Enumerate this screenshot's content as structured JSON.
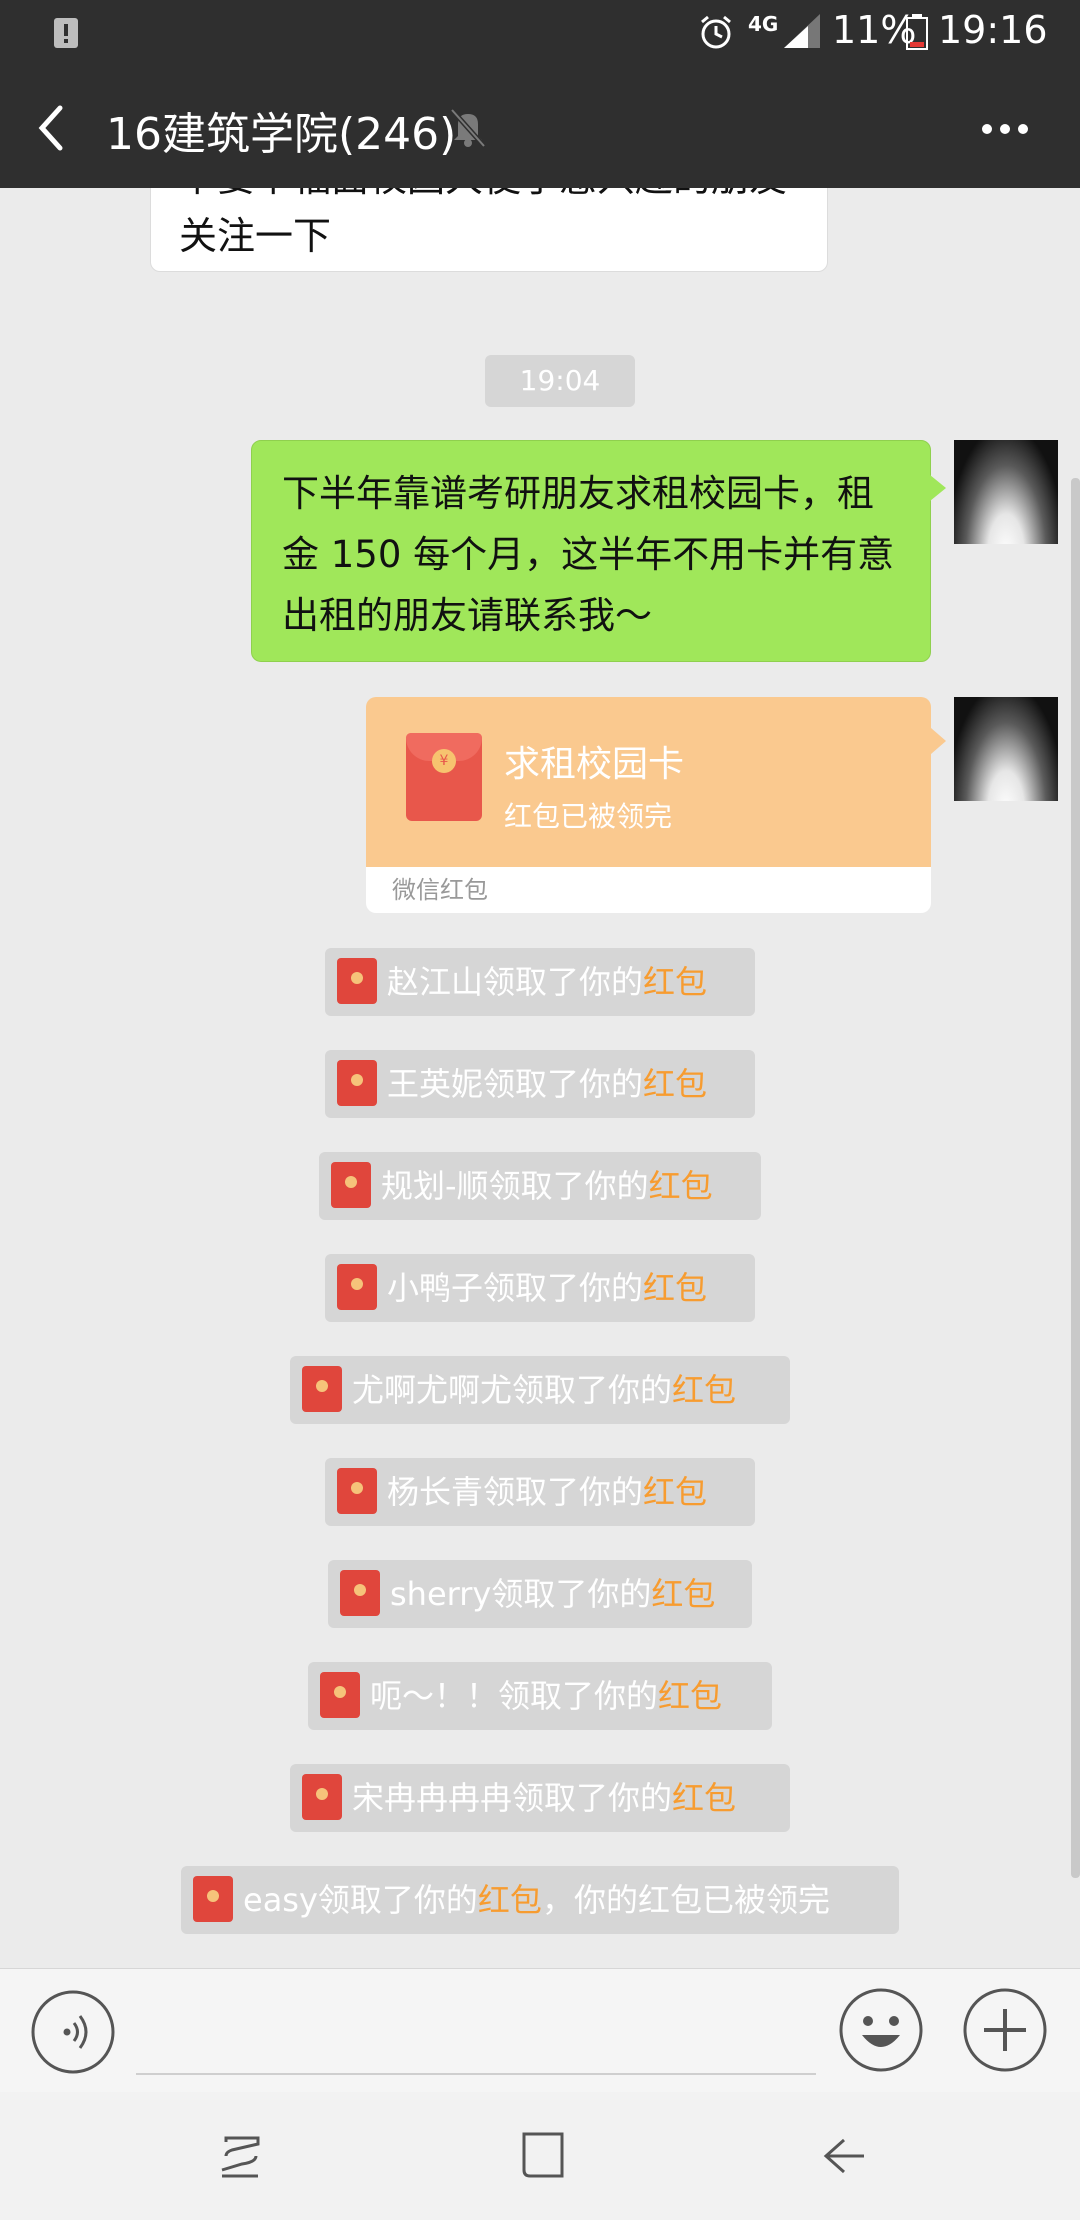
{
  "status_bar": {
    "network": "4G",
    "battery": "11%",
    "time": "19:16"
  },
  "header": {
    "title": "16建筑学院(246)"
  },
  "messages": {
    "partial_top_line": "下要下福面校园大使了感兴趣的朋友",
    "partial_bottom_line": "关注一下",
    "timestamp": "19:04",
    "green_line1": "下半年靠谱考研朋友求租校园卡，租",
    "green_line2": "金 150 每个月，这半年不用卡并有意",
    "green_line3": "出租的朋友请联系我～",
    "red_packet": {
      "title": "求租校园卡",
      "status": "红包已被领完",
      "footer": "微信红包",
      "coin": "¥"
    }
  },
  "notices": [
    {
      "name": "赵江山",
      "text": "领取了你的",
      "highlight": "红包",
      "tail": ""
    },
    {
      "name": "王英妮",
      "text": "领取了你的",
      "highlight": "红包",
      "tail": ""
    },
    {
      "name": "规划-顺",
      "text": "领取了你的",
      "highlight": "红包",
      "tail": ""
    },
    {
      "name": "小鸭子",
      "text": "领取了你的",
      "highlight": "红包",
      "tail": ""
    },
    {
      "name": "尤啊尤啊尤",
      "text": "领取了你的",
      "highlight": "红包",
      "tail": ""
    },
    {
      "name": "杨长青",
      "text": "领取了你的",
      "highlight": "红包",
      "tail": ""
    },
    {
      "name": "sherry",
      "text": "领取了你的",
      "highlight": "红包",
      "tail": ""
    },
    {
      "name": "呃～！！",
      "text": "领取了你的",
      "highlight": "红包",
      "tail": ""
    },
    {
      "name": "宋冉冉冉冉",
      "text": "领取了你的",
      "highlight": "红包",
      "tail": ""
    },
    {
      "name": "easy",
      "text": "领取了你的",
      "highlight": "红包",
      "tail": "，你的红包已被领完"
    }
  ],
  "icons": {
    "alert": "alert-icon",
    "alarm": "alarm-icon",
    "signal": "signal-icon",
    "battery": "battery-icon",
    "back": "back-arrow-icon",
    "mute": "mute-bell-icon",
    "more": "more-icon",
    "voice": "voice-icon",
    "emoji": "emoji-icon",
    "plus": "plus-icon",
    "recent": "recent-apps-icon",
    "home": "home-icon",
    "nav_back": "nav-back-icon"
  },
  "colors": {
    "header_bg": "#2f2f2f",
    "chat_bg": "#ebebeb",
    "green_bubble": "#a0e75a",
    "red_packet": "#fac98f",
    "highlight": "#f79c30"
  }
}
